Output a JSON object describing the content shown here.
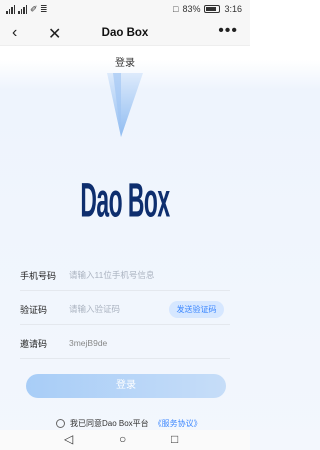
{
  "status": {
    "left": "✐ ≣",
    "battery": "83%",
    "time": "3:16"
  },
  "titlebar": {
    "title": "Dao Box",
    "back": "‹",
    "close": "✕",
    "more": "•••"
  },
  "page": {
    "heading": "登录",
    "logo": "Dao Box"
  },
  "form": {
    "phone_label": "手机号码",
    "phone_placeholder": "请输入11位手机号信息",
    "code_label": "验证码",
    "code_placeholder": "请输入验证码",
    "send_code": "发送验证码",
    "invite_label": "邀请码",
    "invite_value": "3mejB9de"
  },
  "login_button": "登录",
  "agreement": {
    "text": "我已同意Dao Box平台",
    "link": "《服务协议》"
  },
  "nav": {
    "back": "◁",
    "home": "○",
    "recent": "□"
  },
  "colors": {
    "accent": "#3a86ff",
    "logo": "#0e2e6e",
    "login_button": "#b5d3f7"
  }
}
